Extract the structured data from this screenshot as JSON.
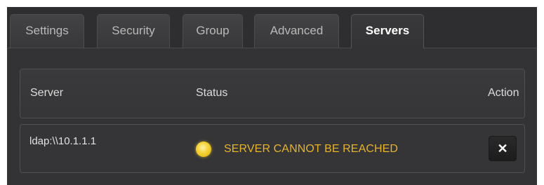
{
  "tabs": [
    {
      "label": "Settings",
      "active": false
    },
    {
      "label": "Security",
      "active": false
    },
    {
      "label": "Group",
      "active": false
    },
    {
      "label": "Advanced",
      "active": false
    },
    {
      "label": "Servers",
      "active": true
    }
  ],
  "table": {
    "columns": {
      "server": "Server",
      "status": "Status",
      "action": "Action"
    },
    "rows": [
      {
        "server": "ldap:\\\\10.1.1.1",
        "status": "SERVER CANNOT BE REACHED",
        "status_color": "#e6b32a",
        "status_icon": "warning-indicator-dot",
        "action_icon": "close-icon",
        "action_label": "✕"
      }
    ]
  },
  "colors": {
    "background": "#333335",
    "tab_active_text": "#ffffff",
    "tab_inactive_text": "#b9b9b9",
    "status_warning": "#e6b32a"
  }
}
